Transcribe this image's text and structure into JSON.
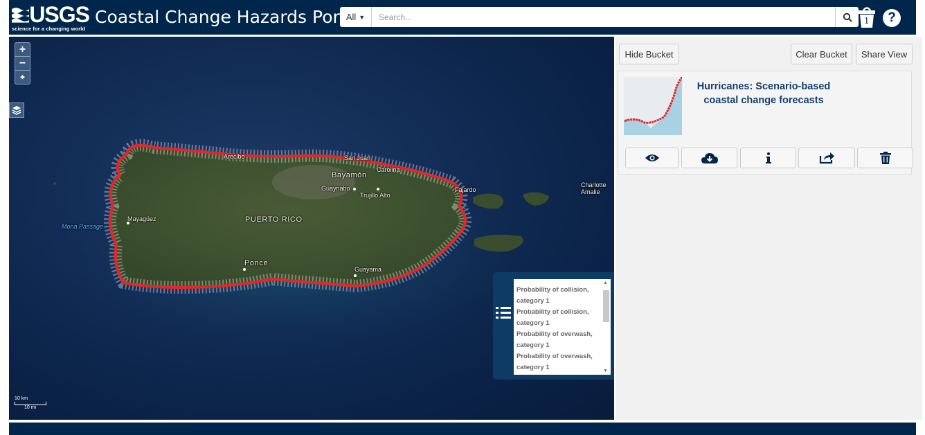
{
  "header": {
    "logo_text": "USGS",
    "logo_tagline": "science for a changing world",
    "title": "Coastal Change Hazards Portal",
    "search": {
      "scope": "All",
      "placeholder": "Search..."
    },
    "bucket_count": "1",
    "icons": {
      "search": "search-icon",
      "bucket": "bucket-icon",
      "help": "help-icon"
    }
  },
  "map": {
    "zoom_in": "+",
    "zoom_out": "−",
    "locate": "⌖",
    "places": {
      "arecibo": "Arecibo",
      "san_juan": "San Juan",
      "carolina": "Carolina",
      "bayamon": "Bayamón",
      "guaynabo": "Guaynabo",
      "trujillo_alto": "Trujillo Alto",
      "fajardo": "Fajardo",
      "charlotte_amalie": "Charlotte Amalie",
      "mayaguez": "Mayagüez",
      "mona_passage": "Mona Passage",
      "puerto_rico": "PUERTO RICO",
      "ponce": "Ponce",
      "guayama": "Guayama"
    },
    "scale": {
      "km": "10 km",
      "mi": "10 mi"
    },
    "legend_items": [
      "Probability of collision, category 1",
      "Probability of collision, category 1",
      "Probability of overwash, category 1",
      "Probability of overwash, category 1"
    ],
    "colors": {
      "coast": "#e32626",
      "water": "#0b2348"
    }
  },
  "bucket": {
    "hide_label": "Hide Bucket",
    "clear_label": "Clear Bucket",
    "share_label": "Share View",
    "item_title": "Hurricanes: Scenario-based coastal change forecasts",
    "actions": [
      "view-eye-icon",
      "download-cloud-icon",
      "info-icon",
      "share-icon",
      "trash-icon"
    ]
  },
  "colors": {
    "brand": "#00264c",
    "title_text": "#153f6b"
  }
}
